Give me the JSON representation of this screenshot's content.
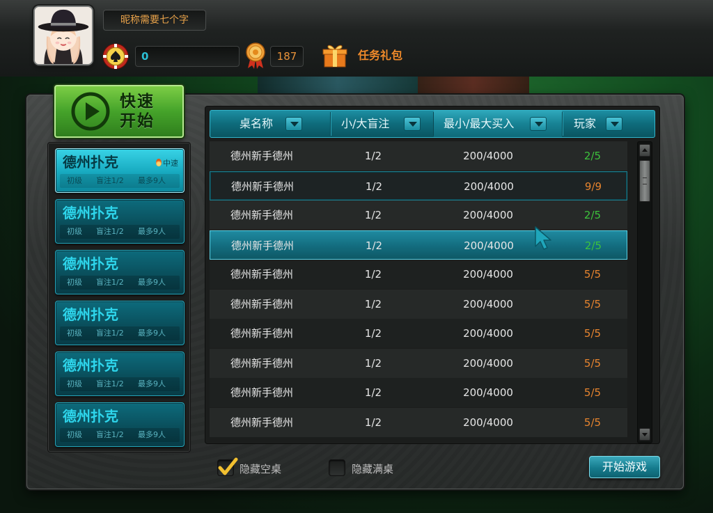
{
  "header": {
    "nickname": "昵称需要七个字",
    "coins": "0",
    "medals": "187",
    "task_label": "任务礼包"
  },
  "quick_start": {
    "line1": "快速",
    "line2": "开始"
  },
  "rooms": [
    {
      "title": "德州扑克",
      "level": "初级",
      "blind": "盲注1/2",
      "max": "最多9人",
      "speed": "中速",
      "active": true
    },
    {
      "title": "德州扑克",
      "level": "初级",
      "blind": "盲注1/2",
      "max": "最多9人",
      "speed": "",
      "active": false
    },
    {
      "title": "德州扑克",
      "level": "初级",
      "blind": "盲注1/2",
      "max": "最多9人",
      "speed": "",
      "active": false
    },
    {
      "title": "德州扑克",
      "level": "初级",
      "blind": "盲注1/2",
      "max": "最多9人",
      "speed": "",
      "active": false
    },
    {
      "title": "德州扑克",
      "level": "初级",
      "blind": "盲注1/2",
      "max": "最多9人",
      "speed": "",
      "active": false
    },
    {
      "title": "德州扑克",
      "level": "初级",
      "blind": "盲注1/2",
      "max": "最多9人",
      "speed": "",
      "active": false
    }
  ],
  "table": {
    "columns": [
      "桌名称",
      "小/大盲注",
      "最小/最大买入",
      "玩家"
    ],
    "rows": [
      {
        "name": "德州新手德州",
        "blinds": "1/2",
        "buyin": "200/4000",
        "players": "2/5",
        "status": "green"
      },
      {
        "name": "德州新手德州",
        "blinds": "1/2",
        "buyin": "200/4000",
        "players": "9/9",
        "status": "orange"
      },
      {
        "name": "德州新手德州",
        "blinds": "1/2",
        "buyin": "200/4000",
        "players": "2/5",
        "status": "green"
      },
      {
        "name": "德州新手德州",
        "blinds": "1/2",
        "buyin": "200/4000",
        "players": "2/5",
        "status": "green"
      },
      {
        "name": "德州新手德州",
        "blinds": "1/2",
        "buyin": "200/4000",
        "players": "5/5",
        "status": "orange"
      },
      {
        "name": "德州新手德州",
        "blinds": "1/2",
        "buyin": "200/4000",
        "players": "5/5",
        "status": "orange"
      },
      {
        "name": "德州新手德州",
        "blinds": "1/2",
        "buyin": "200/4000",
        "players": "5/5",
        "status": "orange"
      },
      {
        "name": "德州新手德州",
        "blinds": "1/2",
        "buyin": "200/4000",
        "players": "5/5",
        "status": "orange"
      },
      {
        "name": "德州新手德州",
        "blinds": "1/2",
        "buyin": "200/4000",
        "players": "5/5",
        "status": "orange"
      },
      {
        "name": "德州新手德州",
        "blinds": "1/2",
        "buyin": "200/4000",
        "players": "5/5",
        "status": "orange"
      }
    ]
  },
  "footer": {
    "hide_empty_label": "隐藏空桌",
    "hide_empty_checked": true,
    "hide_full_label": "隐藏满桌",
    "hide_full_checked": false,
    "start_button": "开始游戏"
  },
  "colors": {
    "accent": "#17a9bf",
    "players_open": "#3cc23c",
    "players_full": "#e7842e",
    "coin_text": "#2bc0d6",
    "nickname_text": "#e8a24a"
  }
}
